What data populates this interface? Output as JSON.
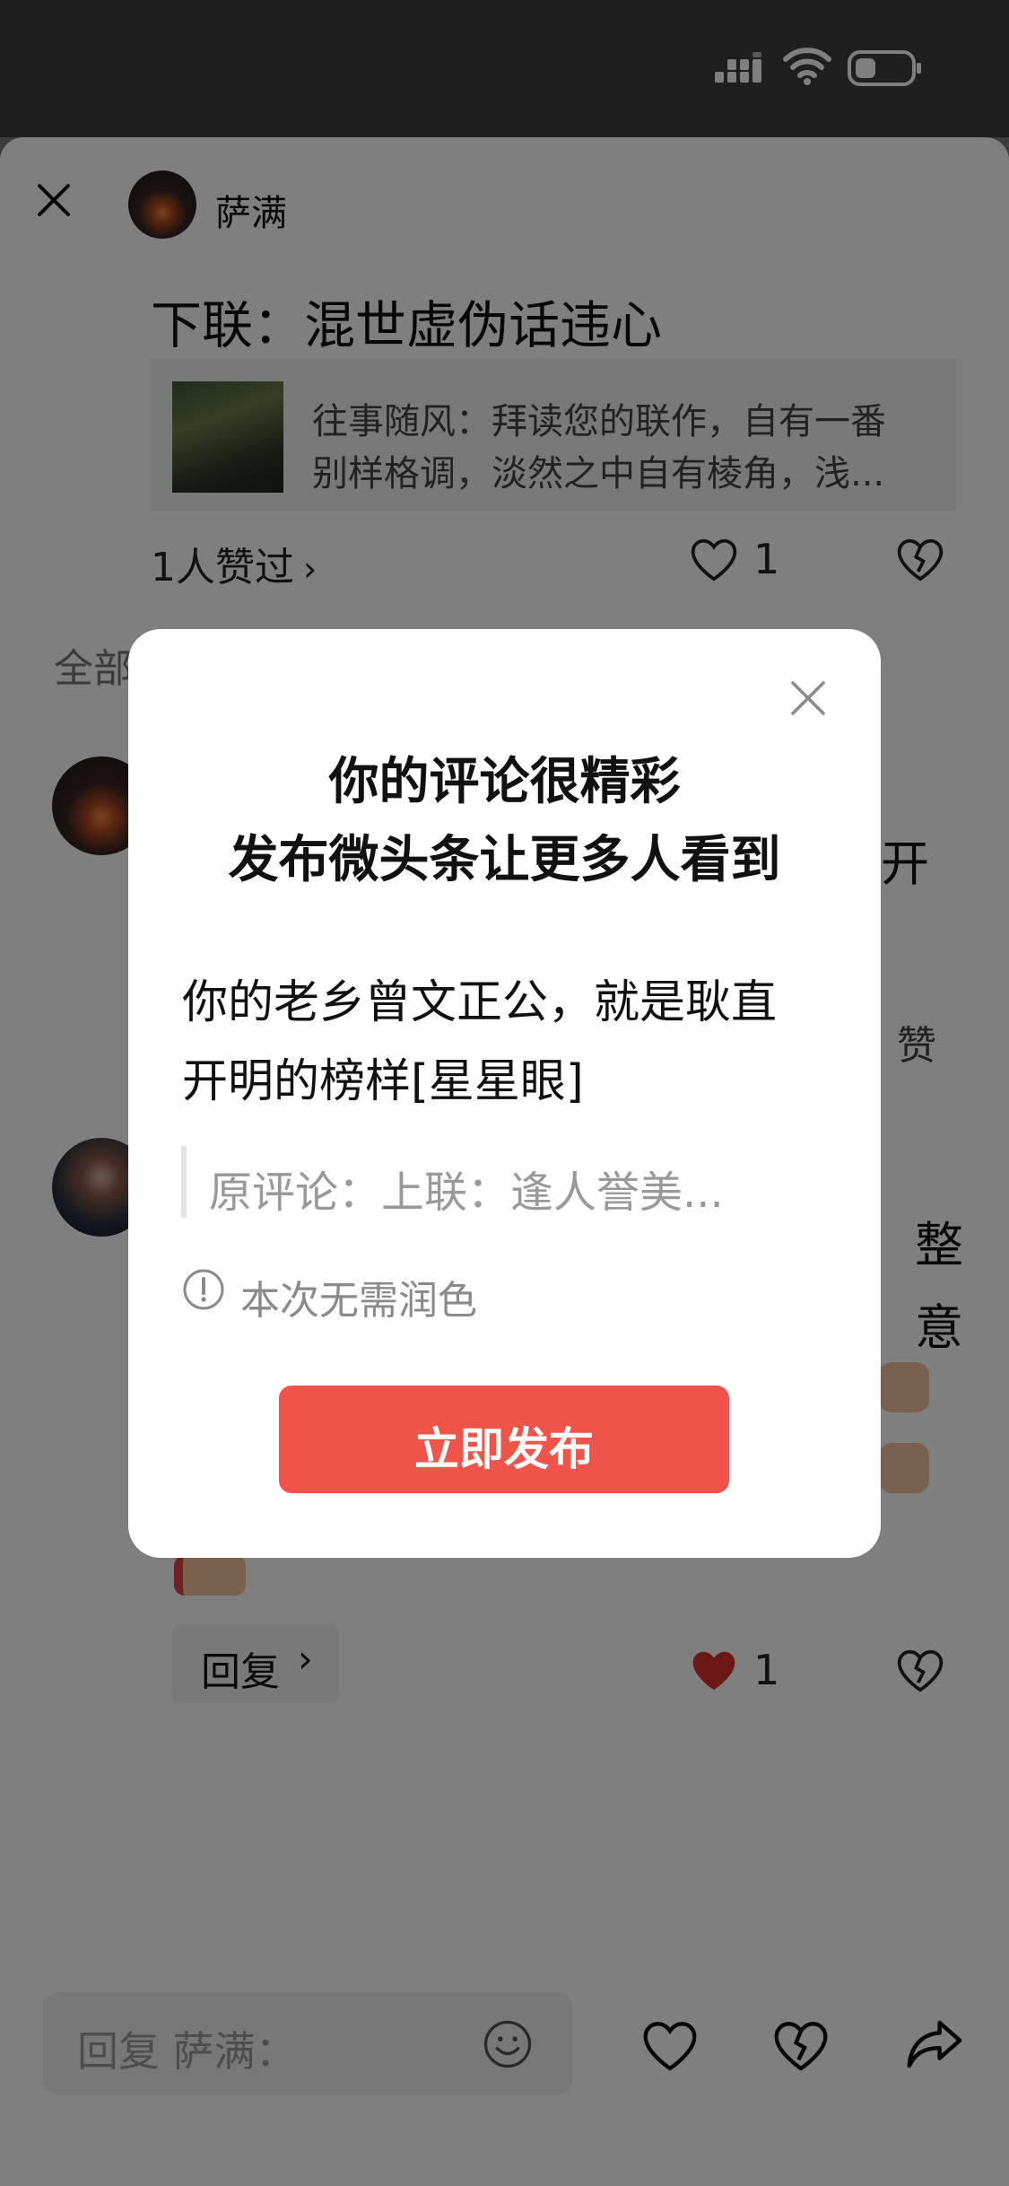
{
  "status_bar": {
    "signal_icon": "signal-bars-icon",
    "wifi_icon": "wifi-icon",
    "battery_icon": "battery-icon"
  },
  "header": {
    "close_icon": "close-icon",
    "author_name": "萨满"
  },
  "post": {
    "title": "下联：混世虚伪话违心",
    "quote": {
      "line1": "往事随风：拜读您的联作，自有一番",
      "line2": "别样格调，淡然之中自有棱角，浅..."
    },
    "likers_label": "1人赞过",
    "like_count": "1"
  },
  "comments": {
    "section_label": "全部",
    "peek": {
      "c1_tail": "开",
      "c1_like": "赞",
      "c2_tail1": "整",
      "c2_tail2": "意"
    },
    "reply_label": "回复",
    "reply_like_count": "1"
  },
  "modal": {
    "title_line1": "你的评论很精彩",
    "title_line2": "发布微头条让更多人看到",
    "body_line1": "你的老乡曾文正公，就是耿直",
    "body_line2": "开明的榜样[星星眼]",
    "original_comment": "原评论：上联：逢人誉美...",
    "notice": "本次无需润色",
    "publish_button": "立即发布"
  },
  "bottom_bar": {
    "reply_placeholder": "回复 萨满：",
    "emoji_icon": "emoji-icon",
    "like_icon": "heart-icon",
    "dislike_icon": "broken-heart-icon",
    "share_icon": "share-icon"
  },
  "colors": {
    "accent_red": "#ee5449",
    "heart_red": "#d8302d"
  }
}
